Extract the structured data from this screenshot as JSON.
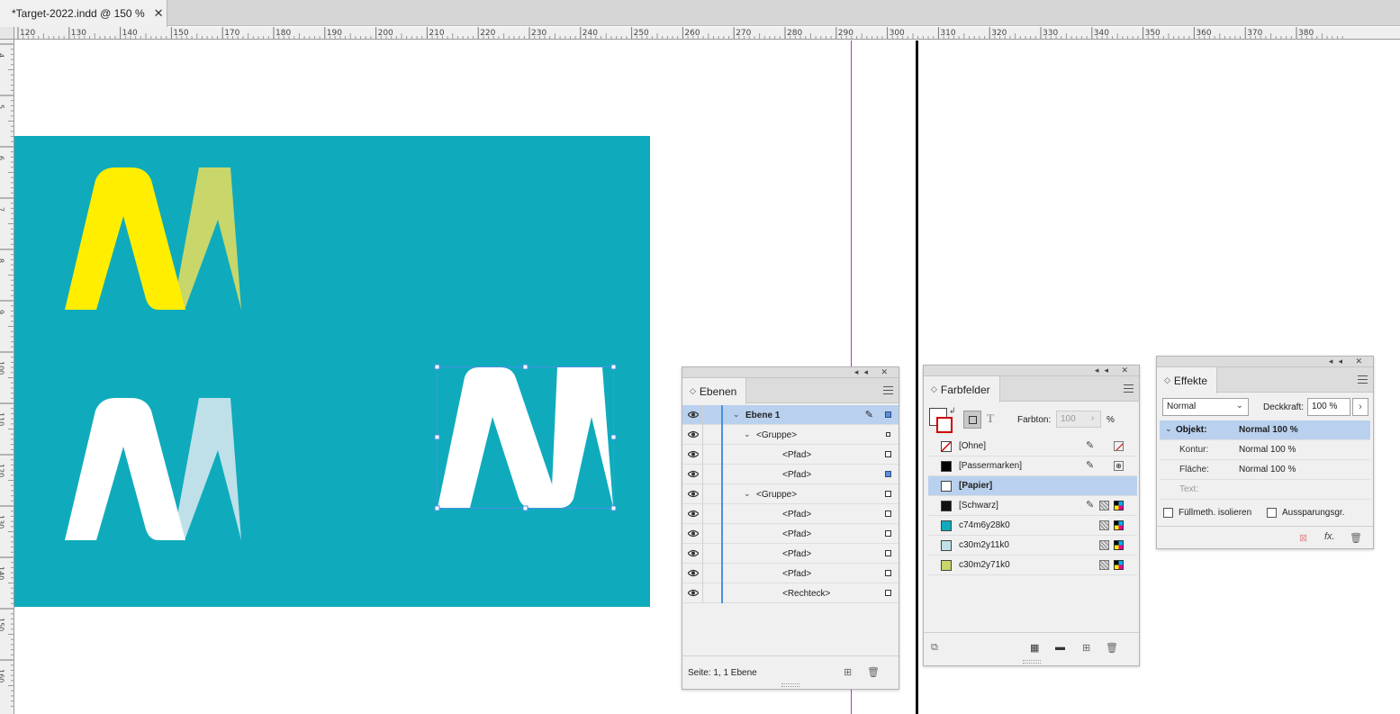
{
  "document_tab": {
    "title": "*Target-2022.indd @ 150 %",
    "close": "✕"
  },
  "ruler_top": [
    "120",
    "130",
    "140",
    "150",
    "170",
    "180",
    "190",
    "200",
    "210",
    "220",
    "230",
    "240",
    "250",
    "260",
    "270",
    "280",
    "290",
    "300",
    "310",
    "320",
    "330",
    "340",
    "350",
    "360",
    "370",
    "380"
  ],
  "ruler_left": [
    "4",
    "5",
    "6",
    "7",
    "8",
    "9",
    "100",
    "110",
    "120",
    "130",
    "140",
    "150",
    "160"
  ],
  "colors": {
    "teal": "#0fabbd",
    "yellow": "#ffee00",
    "olive": "#c8d66a",
    "lightblue": "#bfe0e8",
    "white": "#ffffff",
    "guide": "#b13ab4"
  },
  "layers_panel": {
    "tab": "Ebenen",
    "rows": [
      {
        "label": "Ebene 1",
        "indent": 0,
        "chevron": true,
        "selected": true
      },
      {
        "label": "<Gruppe>",
        "indent": 1,
        "chevron": true
      },
      {
        "label": "<Pfad>",
        "indent": 2,
        "chevron": false
      },
      {
        "label": "<Pfad>",
        "indent": 2,
        "chevron": false
      },
      {
        "label": "<Gruppe>",
        "indent": 1,
        "chevron": true
      },
      {
        "label": "<Pfad>",
        "indent": 2,
        "chevron": false
      },
      {
        "label": "<Pfad>",
        "indent": 2,
        "chevron": false
      },
      {
        "label": "<Pfad>",
        "indent": 2,
        "chevron": false
      },
      {
        "label": "<Pfad>",
        "indent": 2,
        "chevron": false
      },
      {
        "label": "<Rechteck>",
        "indent": 2,
        "chevron": false
      }
    ],
    "footer": "Seite: 1, 1 Ebene"
  },
  "swatches_panel": {
    "tab": "Farbfelder",
    "tint_label": "Farbton:",
    "tint_value": "100",
    "tint_unit": "%",
    "swatches": [
      {
        "name": "[Ohne]",
        "color": "none"
      },
      {
        "name": "[Passermarken]",
        "color": "#000000"
      },
      {
        "name": "[Papier]",
        "color": "#ffffff",
        "selected": true
      },
      {
        "name": "[Schwarz]",
        "color": "#111111"
      },
      {
        "name": "c74m6y28k0",
        "color": "#0fabbd"
      },
      {
        "name": "c30m2y11k0",
        "color": "#bfe0e8"
      },
      {
        "name": "c30m2y71k0",
        "color": "#c8d66a"
      }
    ]
  },
  "effects_panel": {
    "tab": "Effekte",
    "blend_mode": "Normal",
    "opacity_label": "Deckkraft:",
    "opacity_value": "100 %",
    "rows": [
      {
        "key": "Objekt:",
        "value": "Normal 100 %"
      },
      {
        "key": "Kontur:",
        "value": "Normal 100 %"
      },
      {
        "key": "Fläche:",
        "value": "Normal 100 %"
      },
      {
        "key": "Text:",
        "value": ""
      }
    ],
    "isolate_label": "Füllmeth. isolieren",
    "knockout_label": "Aussparungsgr.",
    "fx_label": "fx."
  }
}
